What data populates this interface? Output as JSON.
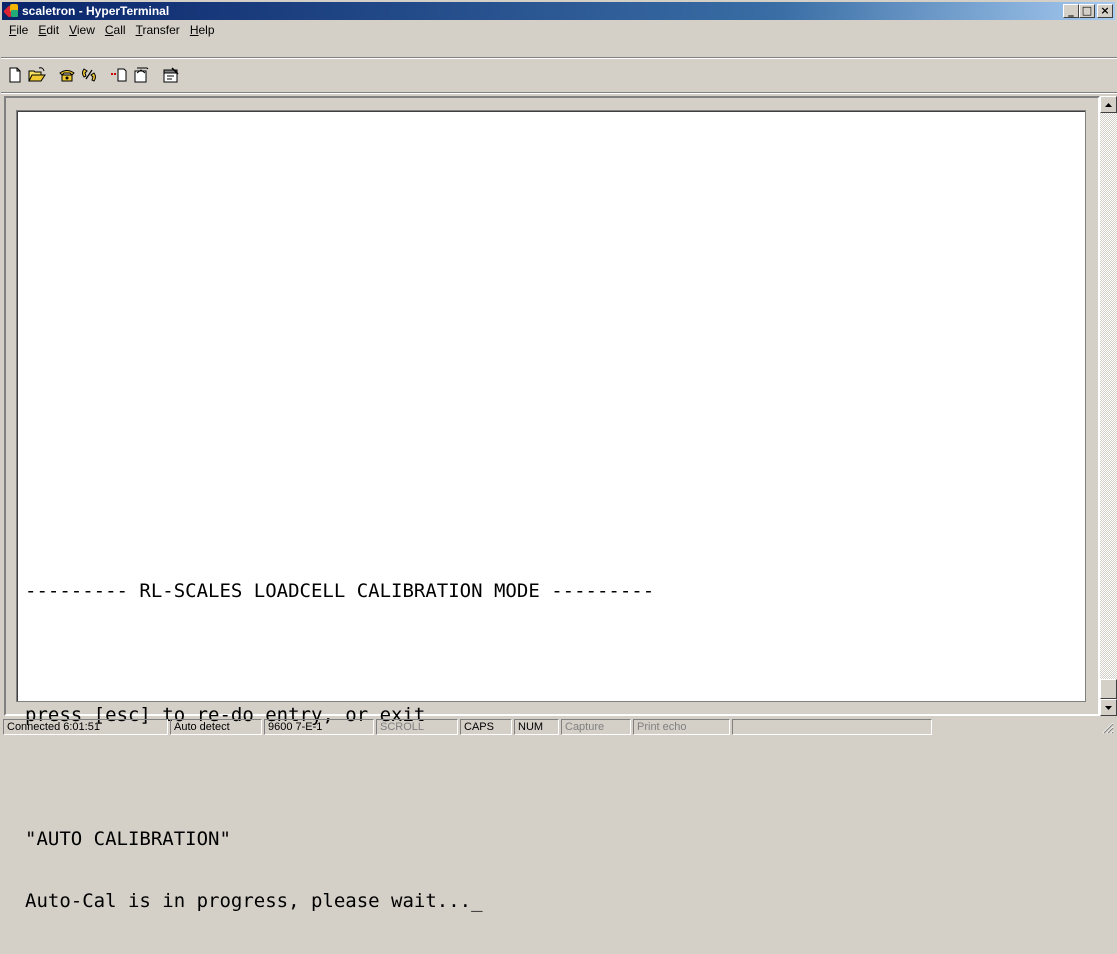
{
  "window": {
    "title": "scaletron - HyperTerminal",
    "minimize": "_",
    "maximize": "□",
    "close": "×"
  },
  "menu": {
    "items": [
      {
        "label": "File",
        "accel": "F",
        "rest": "ile"
      },
      {
        "label": "Edit",
        "accel": "E",
        "rest": "dit"
      },
      {
        "label": "View",
        "accel": "V",
        "rest": "iew"
      },
      {
        "label": "Call",
        "accel": "C",
        "rest": "all"
      },
      {
        "label": "Transfer",
        "accel": "T",
        "rest": "ransfer"
      },
      {
        "label": "Help",
        "accel": "H",
        "rest": "elp"
      }
    ]
  },
  "toolbar": {
    "buttons": [
      {
        "icon": "new-document-icon"
      },
      {
        "icon": "open-folder-icon"
      },
      {
        "icon": "call-phone-icon"
      },
      {
        "icon": "disconnect-phone-icon"
      },
      {
        "icon": "send-icon"
      },
      {
        "icon": "receive-icon"
      },
      {
        "icon": "properties-icon"
      }
    ]
  },
  "terminal": {
    "lines": [
      "--------- RL-SCALES LOADCELL CALIBRATION MODE ---------",
      "",
      "press [esc] to re-do entry, or exit",
      "",
      "\"AUTO CALIBRATION\"",
      "Auto-Cal is in progress, please wait..."
    ],
    "cursor": "_"
  },
  "status": {
    "connected": "Connected 6:01:51",
    "detect": "Auto detect",
    "port": "9600 7-E-1",
    "scroll": "SCROLL",
    "caps": "CAPS",
    "num": "NUM",
    "capture": "Capture",
    "print_echo": "Print echo"
  }
}
